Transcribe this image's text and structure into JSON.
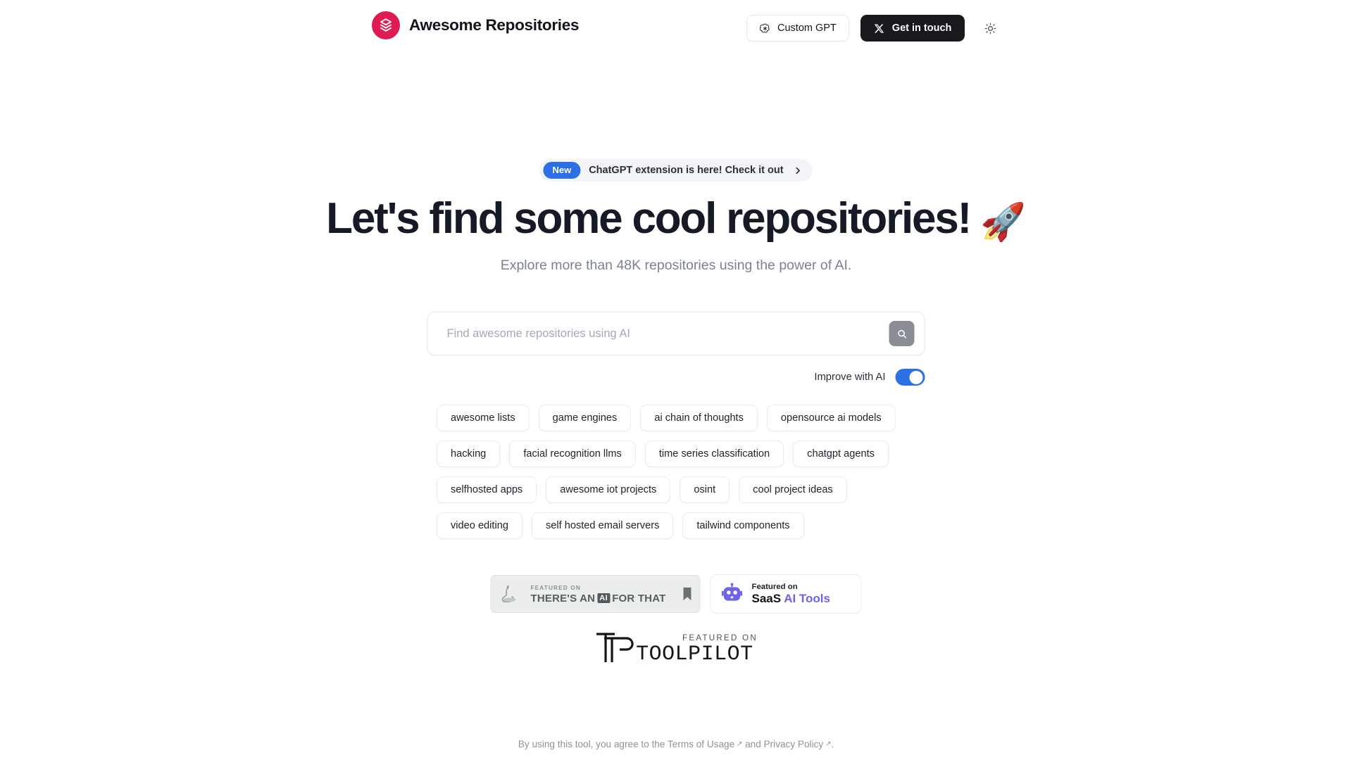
{
  "header": {
    "brand_title": "Awesome Repositories",
    "logo_icon": "layers-stack-icon",
    "logo_color": "#e01b51",
    "custom_gpt_label": "Custom GPT",
    "custom_gpt_icon": "openai-icon",
    "get_in_touch_label": "Get in touch",
    "get_in_touch_icon": "x-twitter-icon",
    "theme_toggle_icon": "sun-icon"
  },
  "announcement": {
    "badge": "New",
    "text": "ChatGPT extension is here! Check it out",
    "chevron_icon": "chevron-right-icon",
    "badge_color": "#2f6fe4"
  },
  "hero": {
    "title": "Let's find some cool repositories!",
    "title_emoji": "🚀",
    "subtitle": "Explore more than 48K repositories using the power of AI."
  },
  "search": {
    "placeholder": "Find awesome repositories using AI",
    "value": "",
    "submit_icon": "search-icon",
    "improve_label": "Improve with AI",
    "improve_enabled": true,
    "toggle_color": "#2f6fe4"
  },
  "tags": [
    "awesome lists",
    "game engines",
    "ai chain of thoughts",
    "opensource ai models",
    "hacking",
    "facial recognition llms",
    "time series classification",
    "chatgpt agents",
    "selfhosted apps",
    "awesome iot projects",
    "osint",
    "cool project ideas",
    "video editing",
    "self hosted email servers",
    "tailwind components"
  ],
  "featured": {
    "taaft": {
      "small": "FEATURED ON",
      "big_pre": "THERE'S AN",
      "chip": "AI",
      "big_post": "FOR THAT",
      "mascot_icon": "taaft-mascot-icon",
      "bookmark_icon": "bookmark-icon"
    },
    "saas": {
      "small": "Featured on",
      "big_bold": "SaaS",
      "big_accent": "AI Tools",
      "icon": "robot-icon",
      "accent_color": "#6c63e8"
    },
    "toolpilot": {
      "small": "FEATURED ON",
      "name": "TOOLPILOT",
      "mark_icon": "toolpilot-tp-icon"
    }
  },
  "footer": {
    "prefix": "By using this tool, you agree to the ",
    "terms_label": "Terms of Usage",
    "middle": " and ",
    "privacy_label": "Privacy Policy",
    "suffix": ".",
    "external_icon": "external-link-arrow-icon"
  }
}
